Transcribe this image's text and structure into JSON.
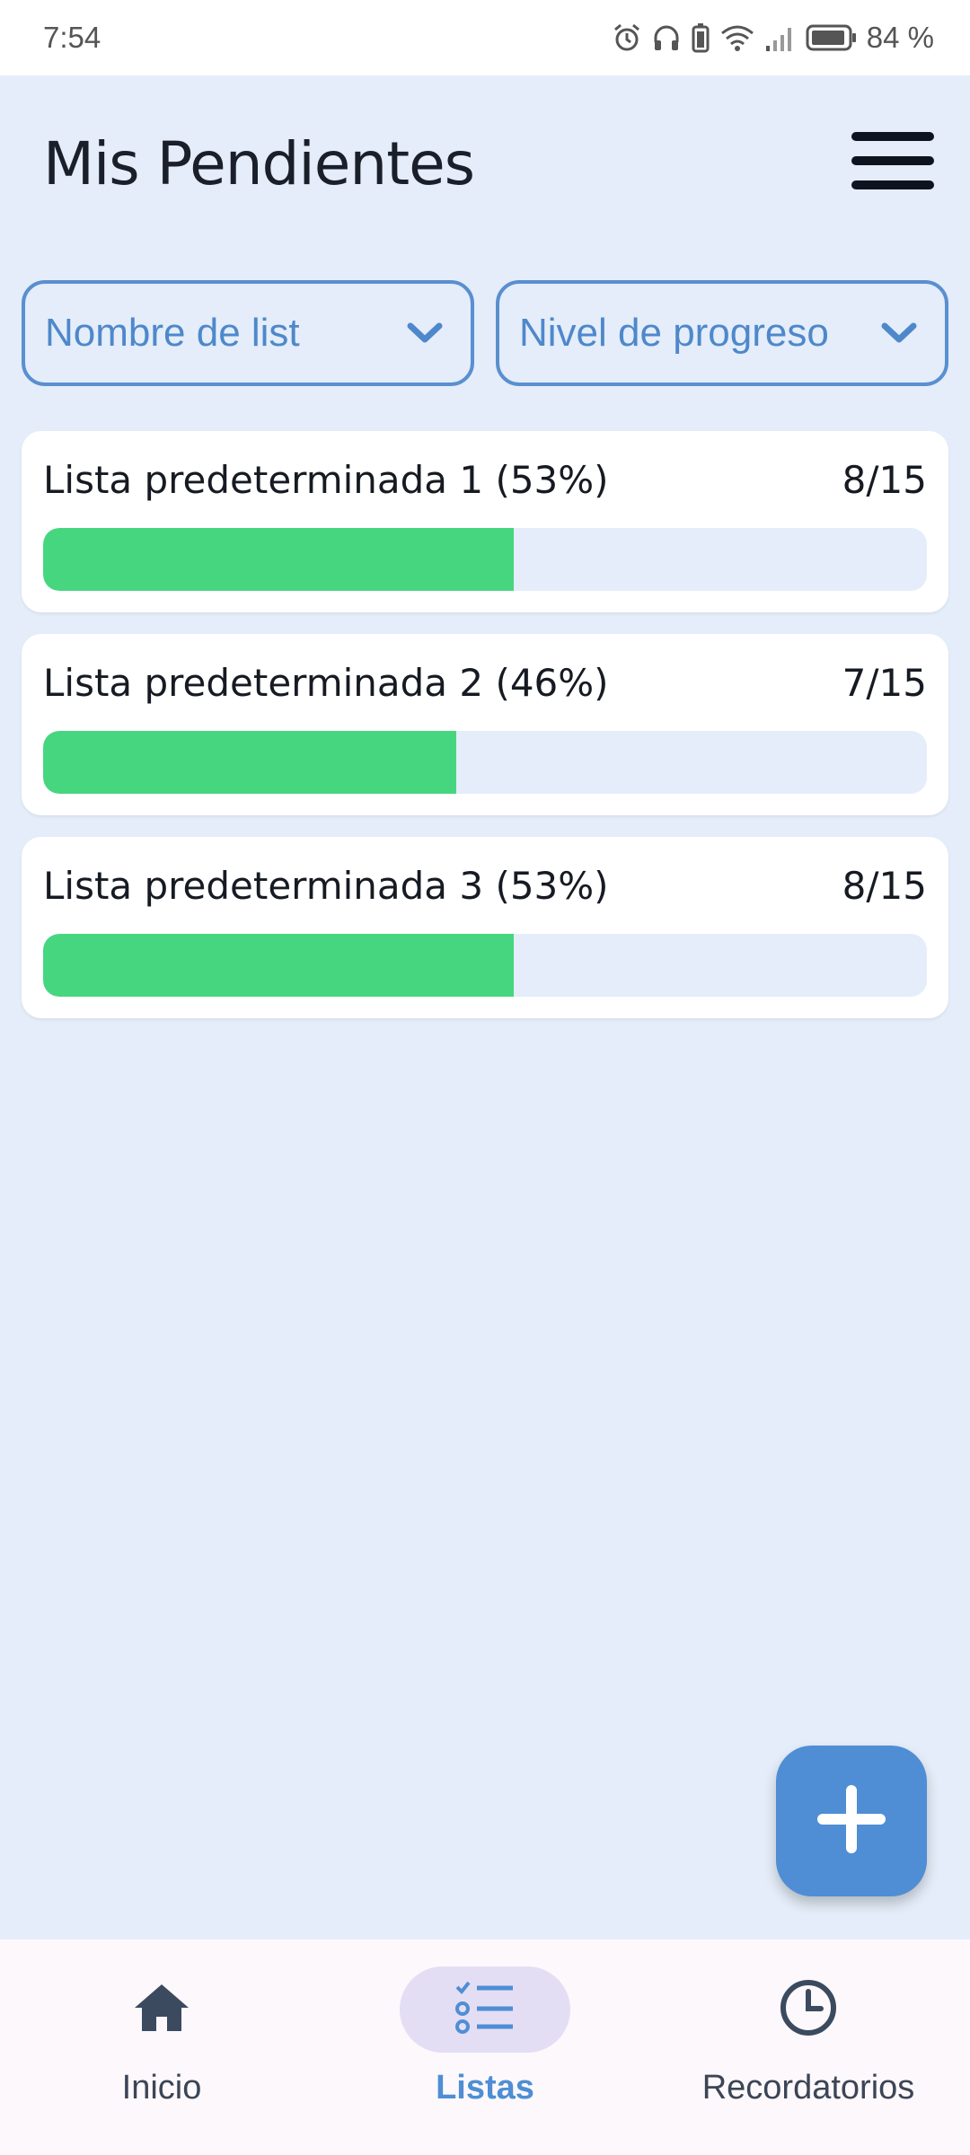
{
  "status_bar": {
    "time": "7:54",
    "battery": "84 %",
    "icons": [
      "alarm-icon",
      "headphones-icon",
      "battery-saver-icon",
      "wifi-icon",
      "signal-icon",
      "battery-icon"
    ]
  },
  "header": {
    "title": "Mis Pendientes",
    "menu_icon": "hamburger-menu-icon"
  },
  "filters": {
    "list_name": "Nombre de list",
    "progress_level": "Nivel de progreso"
  },
  "lists": [
    {
      "title": "Lista predeterminada 1 (53%)",
      "count": "8/15",
      "progress": 0.533
    },
    {
      "title": "Lista predeterminada 2 (46%)",
      "count": "7/15",
      "progress": 0.467
    },
    {
      "title": "Lista predeterminada 3 (53%)",
      "count": "8/15",
      "progress": 0.533
    }
  ],
  "fab": {
    "icon": "plus-icon"
  },
  "bottom_nav": {
    "items": [
      {
        "label": "Inicio",
        "icon": "home-icon",
        "active": false
      },
      {
        "label": "Listas",
        "icon": "checklist-icon",
        "active": true
      },
      {
        "label": "Recordatorios",
        "icon": "clock-icon",
        "active": false
      }
    ]
  },
  "colors": {
    "background": "#e4edf9",
    "accent": "#4f8ed4",
    "progress": "#47d680",
    "nav_active_bg": "#e4def4"
  }
}
